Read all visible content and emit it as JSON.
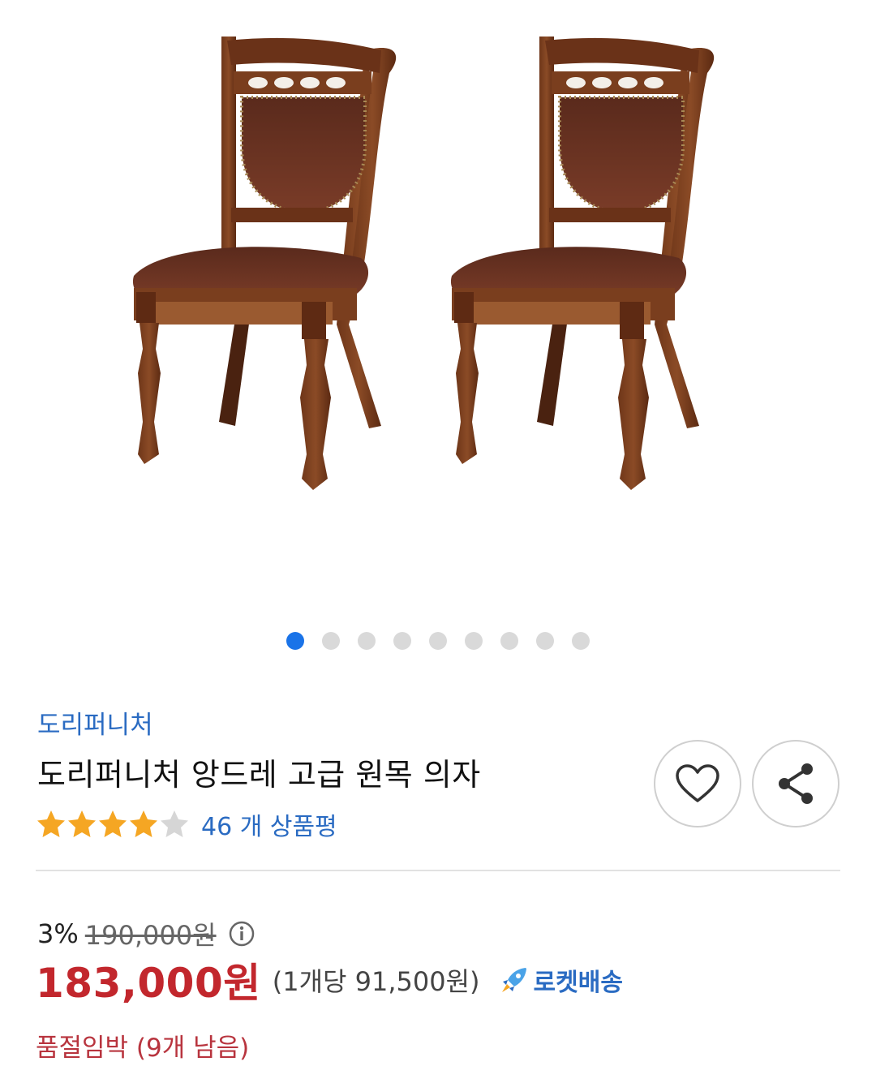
{
  "gallery": {
    "dot_count": 9,
    "active_index": 0
  },
  "product": {
    "brand": "도리퍼니처",
    "title": "도리퍼니처 앙드레 고급 원목 의자",
    "rating": 4,
    "rating_max": 5,
    "review_count_text": "46 개 상품평"
  },
  "actions": {
    "wishlist_icon": "heart-icon",
    "share_icon": "share-icon"
  },
  "pricing": {
    "discount": "3%",
    "original_price": "190,000원",
    "sale_price": "183,000원",
    "unit_price": "(1개당 91,500원)",
    "delivery_badge": "로켓배송"
  },
  "stock": {
    "status": "품절임박 (9개 남음)"
  },
  "colors": {
    "accent_blue": "#1a73e8",
    "brand_blue": "#2a6bc2",
    "price_red": "#c2272d",
    "star_orange": "#f5a623",
    "stock_red": "#b8343e"
  }
}
